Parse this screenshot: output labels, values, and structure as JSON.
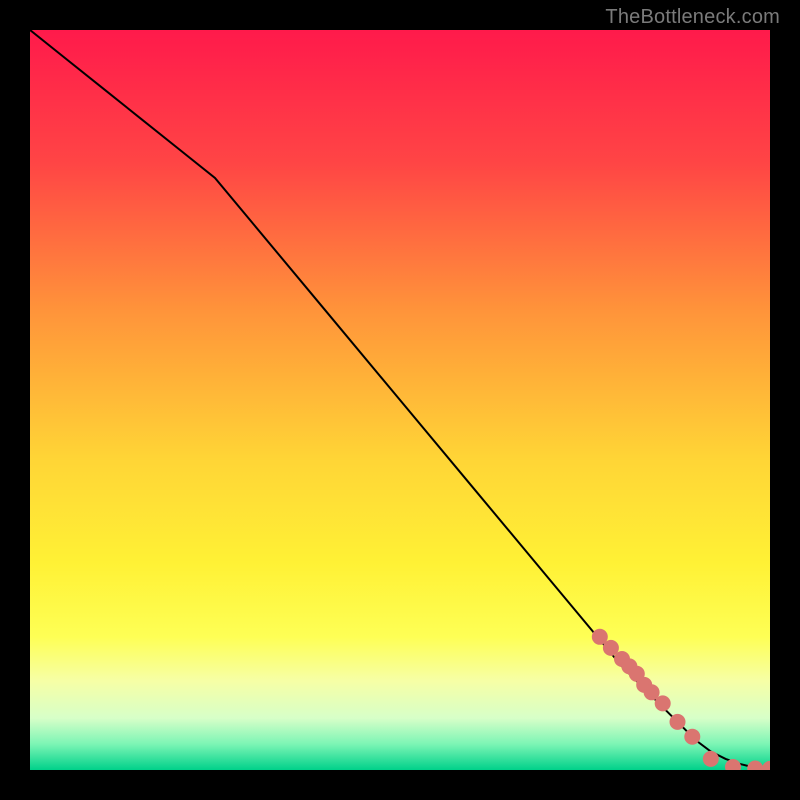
{
  "attribution": "TheBottleneck.com",
  "chart_data": {
    "type": "line",
    "title": "",
    "xlabel": "",
    "ylabel": "",
    "xlim": [
      0,
      100
    ],
    "ylim": [
      0,
      100
    ],
    "grid": false,
    "legend": false,
    "background_gradient": {
      "stops": [
        {
          "offset": 0.0,
          "color": "#ff1a4b"
        },
        {
          "offset": 0.18,
          "color": "#ff4545"
        },
        {
          "offset": 0.38,
          "color": "#ff943a"
        },
        {
          "offset": 0.58,
          "color": "#ffd536"
        },
        {
          "offset": 0.72,
          "color": "#fff135"
        },
        {
          "offset": 0.82,
          "color": "#feff55"
        },
        {
          "offset": 0.88,
          "color": "#f6ffa6"
        },
        {
          "offset": 0.93,
          "color": "#d7ffc8"
        },
        {
          "offset": 0.965,
          "color": "#7cf5b5"
        },
        {
          "offset": 1.0,
          "color": "#00d18a"
        }
      ]
    },
    "series": [
      {
        "name": "curve",
        "color": "#000000",
        "stroke_width": 2,
        "x": [
          0,
          5,
          10,
          15,
          20,
          25,
          30,
          40,
          50,
          60,
          70,
          80,
          85,
          88,
          90,
          92,
          94,
          96,
          98,
          100
        ],
        "y": [
          100,
          96,
          92,
          88,
          84,
          80,
          74,
          62,
          50,
          38,
          26,
          14,
          9,
          6,
          4,
          2.5,
          1.5,
          0.8,
          0.3,
          0.1
        ]
      }
    ],
    "markers": {
      "name": "dots",
      "color": "#da7570",
      "radius": 8,
      "x": [
        77,
        78.5,
        80,
        81,
        82,
        83,
        84,
        85.5,
        87.5,
        89.5,
        92,
        95,
        98,
        100
      ],
      "y": [
        18,
        16.5,
        15,
        14,
        13,
        11.5,
        10.5,
        9,
        6.5,
        4.5,
        1.5,
        0.4,
        0.2,
        0.15
      ]
    }
  }
}
